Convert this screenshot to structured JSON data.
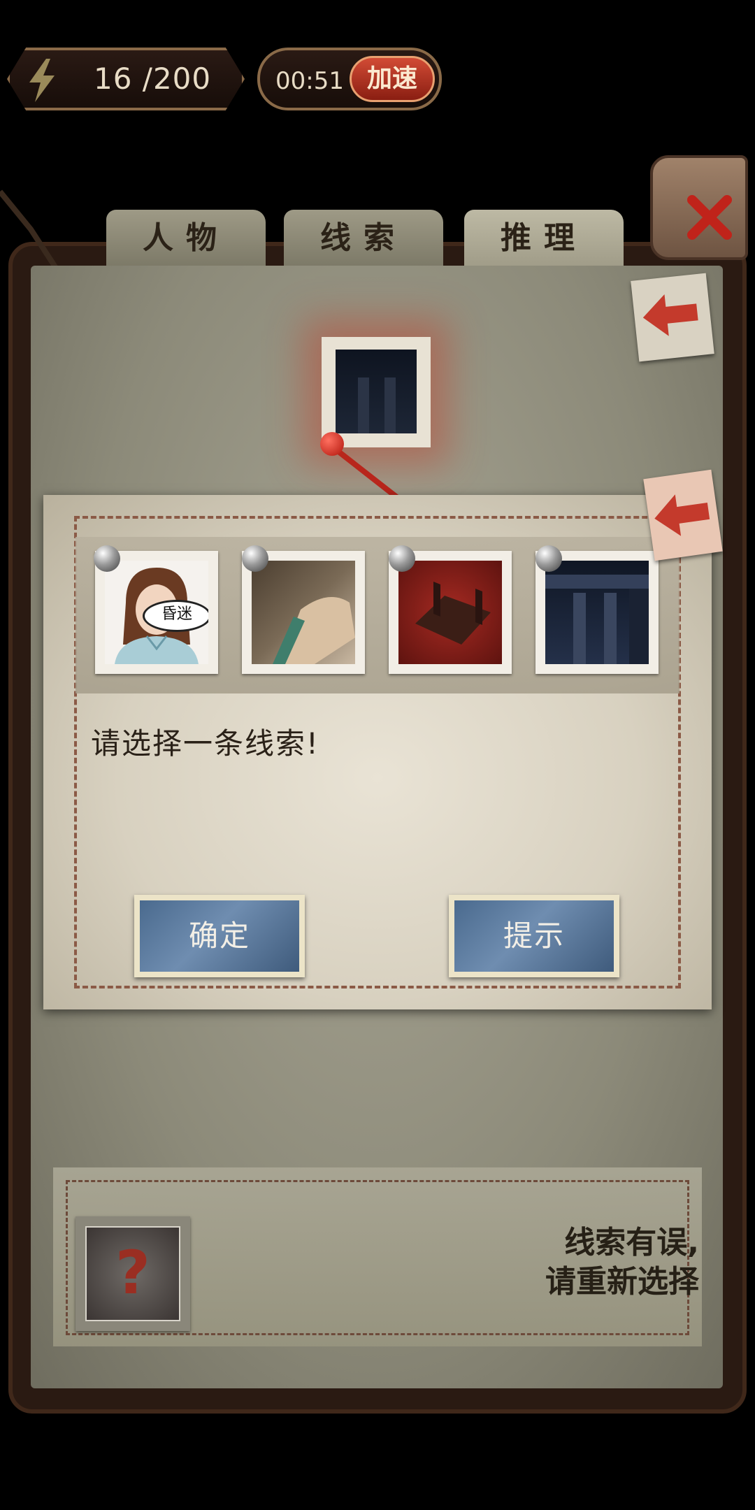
{
  "status": {
    "energy": "16 /200",
    "timer": "00:51",
    "speed_label": "加速"
  },
  "tabs": [
    {
      "label": "人物"
    },
    {
      "label": "线索"
    },
    {
      "label": "推理"
    }
  ],
  "dialog": {
    "clues": [
      {
        "name": "woman-portrait",
        "badge": "昏迷"
      },
      {
        "name": "wrist-hand"
      },
      {
        "name": "wooden-stool"
      },
      {
        "name": "dark-building"
      }
    ],
    "prompt": "请选择一条线索!",
    "confirm_label": "确定",
    "hint_label": "提示"
  },
  "bottom": {
    "unknown_symbol": "?",
    "error_line1": "线索有误,",
    "error_line2": "请重新选择"
  }
}
